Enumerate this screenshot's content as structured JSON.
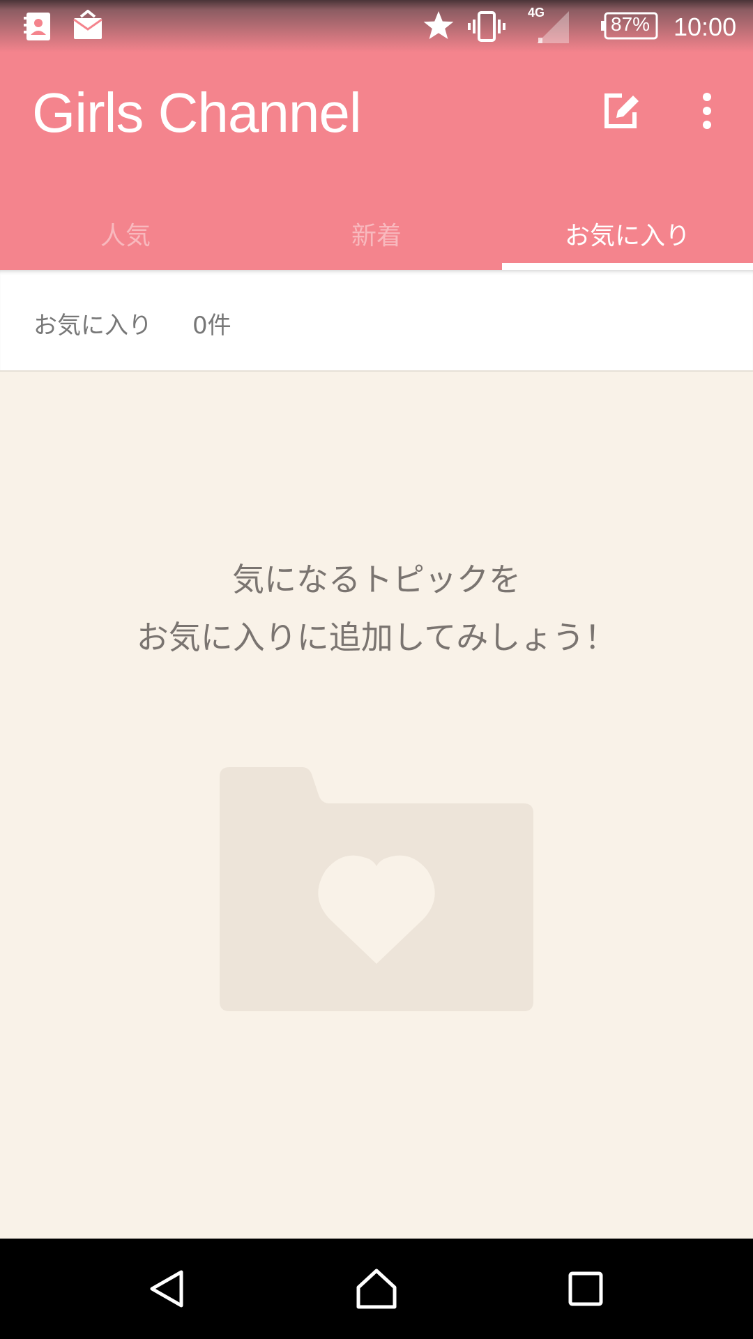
{
  "status_bar": {
    "network": "4G",
    "battery": "87%",
    "time": "10:00"
  },
  "app_bar": {
    "title": "Girls Channel"
  },
  "tabs": [
    {
      "label": "人気",
      "active": false
    },
    {
      "label": "新着",
      "active": false
    },
    {
      "label": "お気に入り",
      "active": true
    }
  ],
  "favorites": {
    "label": "お気に入り",
    "count": "0件"
  },
  "empty_state": {
    "line1": "気になるトピックを",
    "line2": "お気に入りに追加してみしょう！"
  },
  "colors": {
    "accent": "#f4848d",
    "background": "#f9f2e8",
    "folder": "#ede4d9"
  }
}
